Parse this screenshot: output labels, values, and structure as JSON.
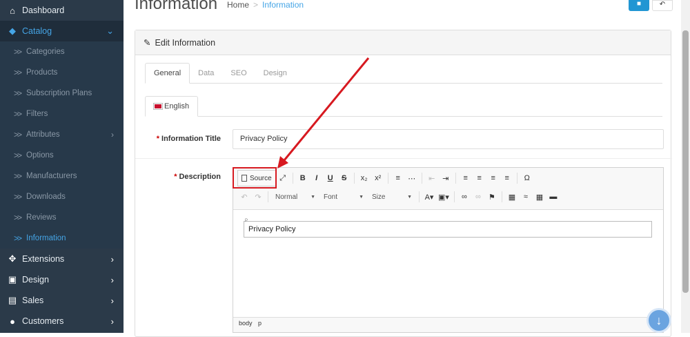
{
  "sidebar": {
    "items": [
      {
        "label": "Dashboard",
        "icon": "home-icon"
      },
      {
        "label": "Catalog",
        "icon": "tag-icon"
      },
      {
        "label": "Extensions",
        "icon": "puzzle-icon"
      },
      {
        "label": "Design",
        "icon": "monitor-icon"
      },
      {
        "label": "Sales",
        "icon": "cart-icon"
      },
      {
        "label": "Customers",
        "icon": "user-icon"
      }
    ],
    "catalog_sub": [
      {
        "label": "Categories"
      },
      {
        "label": "Products"
      },
      {
        "label": "Subscription Plans"
      },
      {
        "label": "Filters"
      },
      {
        "label": "Attributes"
      },
      {
        "label": "Options"
      },
      {
        "label": "Manufacturers"
      },
      {
        "label": "Downloads"
      },
      {
        "label": "Reviews"
      },
      {
        "label": "Information"
      }
    ]
  },
  "header": {
    "title": "Information",
    "breadcrumb_home": "Home",
    "breadcrumb_current": "Information"
  },
  "panel": {
    "title": "Edit Information",
    "tabs": [
      "General",
      "Data",
      "SEO",
      "Design"
    ],
    "lang_tab": "English"
  },
  "form": {
    "title_label": "Information Title",
    "title_value": "Privacy Policy",
    "description_label": "Description"
  },
  "editor": {
    "source_label": "Source",
    "format_combo": "Normal",
    "font_combo": "Font",
    "size_combo": "Size",
    "content_text": "Privacy Policy",
    "p_marker": "P",
    "path": [
      "body",
      "p"
    ]
  },
  "colors": {
    "sidebar_bg": "#2b3a49",
    "accent": "#45a5e6",
    "annotation_red": "#d71920",
    "primary_button": "#2196d3"
  }
}
